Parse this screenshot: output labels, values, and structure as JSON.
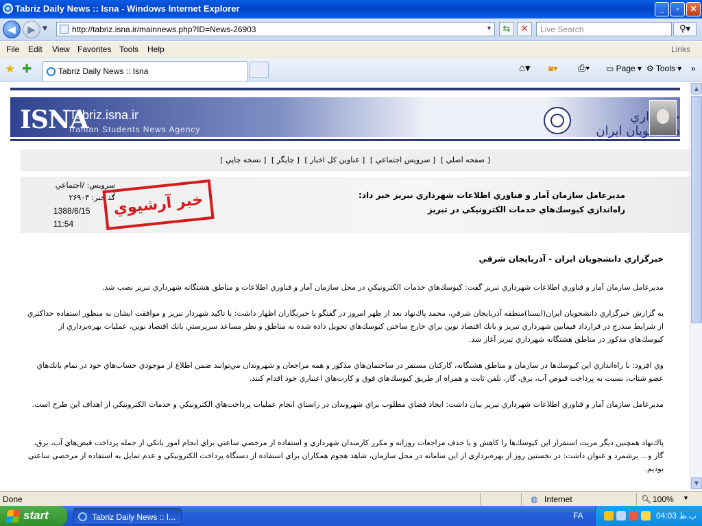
{
  "window": {
    "title": "Tabriz Daily News :: Isna - Windows Internet Explorer",
    "minimize": "_",
    "maximize": "▫",
    "close": "✕"
  },
  "navbar": {
    "url": "http://tabriz.isna.ir/mainnews.php?ID=News-26903",
    "search_placeholder": "Live Search"
  },
  "menu": [
    "File",
    "Edit",
    "View",
    "Favorites",
    "Tools",
    "Help"
  ],
  "menu_links": "Links",
  "tabs": [
    {
      "label": "Tabriz Daily News :: Isna"
    }
  ],
  "toolbar": {
    "page": "Page",
    "tools": "Tools"
  },
  "banner": {
    "logo": "ISNA",
    "site": "Tabriz.isna.ir",
    "tagline": "Iranian Students News Agency",
    "fa_logo": "خبرگزاري دانشجويان ايران"
  },
  "links": [
    "[ صفحه اصلي ]",
    "[ سرويس اجتماعي ]",
    "[ عناوين كل اخبار ]",
    "[ چاپگر ]",
    "[ نسخه چاپي ]"
  ],
  "news": {
    "headline1": "مديرعامل سازمان آمار و فناوري اطلاعات شهرداري تبريز خبر داد:",
    "headline2": "راه‌اندازي كيوسك‌هاي خدمات الكترونيكي در تبريز",
    "service": "سرويس: /اجتماعي /",
    "code": "كد خبر: ۲۶۹۰۳",
    "date": "1388/6/15",
    "time": "11:54",
    "stamp": "خبر آرشيوي"
  },
  "article": {
    "agency": "خبرگزاري دانشجويان ايران - آذربايجان شرقي",
    "p1": "مديرعامل سازمان آمار و فناوري اطلاعات شهرداري تبريز گفت: كيوسك‌هاي خدمات الكترونيكي در محل سازمان آمار و فناوري اطلاعات و مناطق هشتگانه شهرداري تبريز نصب شد.",
    "p2": "به گزارش خبرگزاري دانشجويان ايران(ايسنا)منطقه آذربايجان شرقي، محمد پاك‌نهاد بعد از ظهر امروز در گفتگو با خبرنگاران اظهار داشت: با تاكيد شهردار تبريز و موافقت ايشان به منظور استفاده حداكثري از شرايط مندرج در قرارداد فيمابين شهرداري تبريز و بانك اقتصاد نوين براي خارج ساختن كيوسك‌هاي تحويل داده شده به مناطق و نظر مساعد سرپرستي بانك اقتصاد نوين، عمليات بهره‌برداري از كيوسك‌هاي مذكور در مناطق هشتگانه شهرداري تبريز آغاز شد.",
    "p3": "وي افزود: با راه‌اندازي اين كيوسك‌ها در سازمان و مناطق هشتگانه، كاركنان مستقر در ساختمان‌هاي مذكور و همه مراجعان و شهروندان مي‌توانند ضمن اطلاع از موجودي حساب‌هاي خود در تمام بانك‌هاي عضو شتاب، نسبت به پرداخت قبوض آب، برق، گاز، تلفن ثابت و همراه از طريق كيوسك‌هاي فوق و كارت‌هاي اعتباري خود اقدام كنند.",
    "p4": "مديرعامل سازمان آمار و فناوري اطلاعات شهرداري تبريز بيان داشت: ايجاد فضاي مطلوب براي شهروندان در راستاي انجام عمليات پرداخت‌هاي الكترونيكي و خدمات الكترونيكي از اهداف اين طرح است.",
    "p5": "پاك‌نهاد همچنين ديگر مزيت استقرار اين كيوسك‌ها را كاهش و يا حذف مراجعات روزانه و مكرر كارمندان شهرداري و استفاده از مرخصي ساعتي براي انجام امور بانكي از جمله پرداخت قبض‌هاي آب، برق، گاز و... برشمرد و عنوان داشت: در نخستين روز از بهره‌برداري از اين سامانه در محل سازمان، شاهد هجوم همكاران براي استفاده از دستگاه پرداخت الكترونيكي و عدم تمايل به استفاده از مرخصي ساعتي بوديم."
  },
  "status": {
    "text": "Done",
    "zone": "Internet",
    "zoom": "100%"
  },
  "taskbar": {
    "start": "start",
    "item": "Tabriz Daily News :: I...",
    "lang": "FA",
    "clock": "04:03 ب.ظ"
  }
}
